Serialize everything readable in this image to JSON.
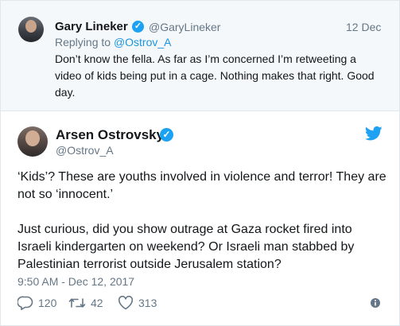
{
  "reply_tweet": {
    "name": "Gary Lineker",
    "handle": "@GaryLineker",
    "date": "12 Dec",
    "replying_prefix": "Replying to ",
    "replying_to": "@Ostrov_A",
    "text": "Don’t know the fella. As far as I’m concerned I’m retweeting a video of kids being put in a cage. Nothing makes that right. Good day."
  },
  "main_tweet": {
    "name": "Arsen Ostrovsky",
    "handle": "@Ostrov_A",
    "paragraph1": "‘Kids’? These are youths involved in violence and terror! They are not so ‘innocent.’",
    "paragraph2": "Just curious, did you show outrage at Gaza rocket fired into Israeli kindergarten on weekend? Or Israeli man stabbed by Palestinian terrorist outside Jerusalem station?",
    "timestamp": "9:50 AM - Dec 12, 2017",
    "actions": {
      "replies": "120",
      "retweets": "42",
      "likes": "313"
    }
  },
  "icons": {
    "verified": "verified-badge-icon",
    "bird": "twitter-bird-icon",
    "reply": "reply-icon",
    "retweet": "retweet-icon",
    "like": "heart-icon",
    "more": "info-icon"
  },
  "colors": {
    "accent": "#1da1f2",
    "link": "#1b95e0",
    "muted": "#657786",
    "reply_bg": "#f5f8fa"
  }
}
